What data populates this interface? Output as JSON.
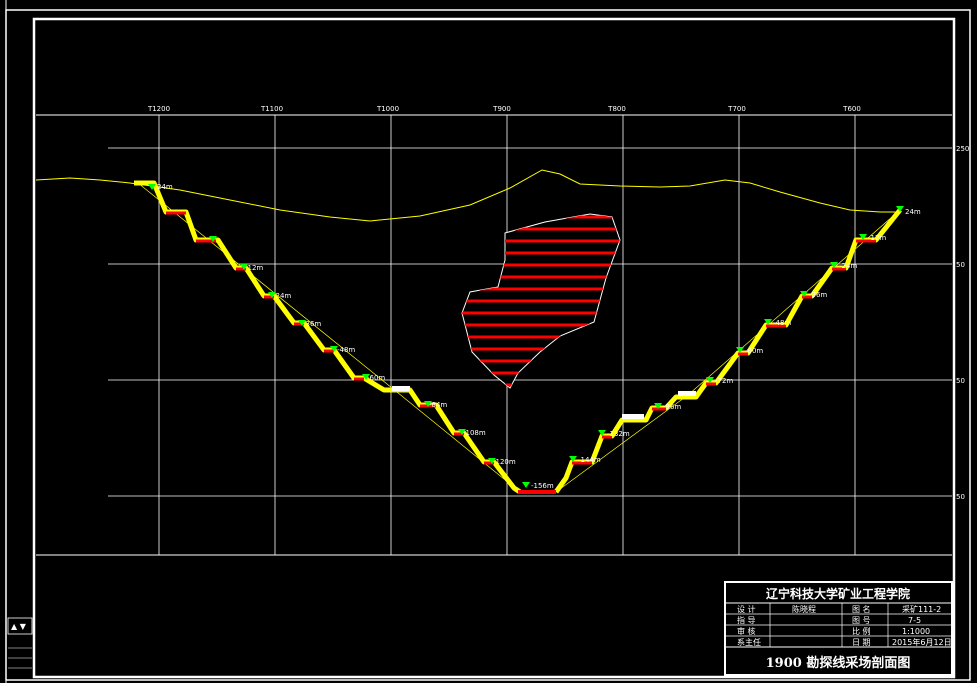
{
  "grid": {
    "top_labels": [
      "T1200",
      "T1100",
      "T1000",
      "T900",
      "T800",
      "T700",
      "T600"
    ],
    "right_labels": [
      "250",
      "50",
      "50",
      "50"
    ]
  },
  "benches": {
    "left": [
      "24m",
      "-12m",
      "-24m",
      "-36m",
      "-48m",
      "-60m",
      "-84m",
      "-108m",
      "-120m"
    ],
    "bottom": "-156m",
    "right": [
      "-144m",
      "-132m",
      "-96m",
      "-72m",
      "-60m",
      "-48m",
      "-36m",
      "-24m",
      "-12m",
      "24m"
    ]
  },
  "legend": {
    "symbol": "▲ ▼"
  },
  "title_block": {
    "school": "辽宁科技大学矿业工程学院",
    "rows": [
      {
        "k1": "设  计",
        "v1": "陈晓程",
        "k2": "图  名",
        "v2": "采矿111-2"
      },
      {
        "k1": "指  导",
        "v1": "",
        "k2": "图  号",
        "v2": "7-5"
      },
      {
        "k1": "审  核",
        "v1": "",
        "k2": "比  例",
        "v2": "1:1000"
      },
      {
        "k1": "系主任",
        "v1": "",
        "k2": "日  期",
        "v2": "2015年6月12日"
      }
    ],
    "drawing_title": "1900 勘探线采场剖面图"
  },
  "colors": {
    "background": "#000000",
    "frame": "#ffffff",
    "terrain": "#ffff00",
    "bench": "#ffff00",
    "berm": "#ff0000",
    "marker": "#00ff00",
    "ore_fill": "#ff0000"
  }
}
